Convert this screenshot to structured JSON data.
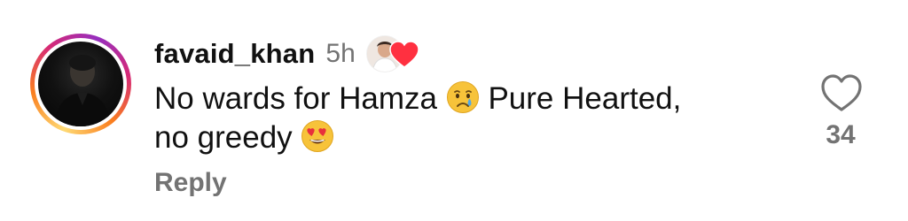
{
  "comment": {
    "username": "favaid_khan",
    "time": "5h",
    "text_line1": "No wards for Hamza",
    "text_line1b": "Pure Hearted,",
    "text_line2": "no greedy",
    "reply_label": "Reply",
    "like_count": "34",
    "icons": {
      "liked_by_author_heart": "heart-filled-icon",
      "like": "heart-outline-icon",
      "emoji1": "crying-face-emoji",
      "emoji2": "heart-eyes-emoji"
    },
    "colors": {
      "heart_red": "#ff3040",
      "muted_text": "#737373"
    }
  }
}
